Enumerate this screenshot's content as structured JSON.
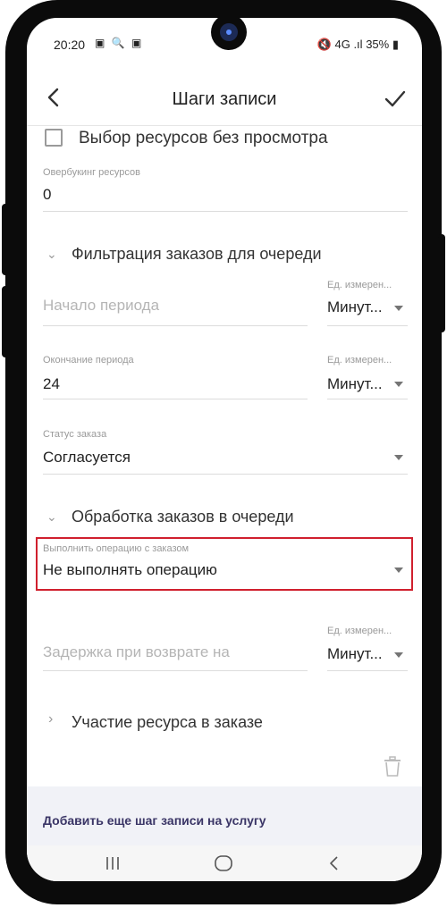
{
  "status_bar": {
    "time": "20:20",
    "left_icons": "▣ 🔍 ▣",
    "right_icons": "🔇 4G .ıl",
    "battery": "35%"
  },
  "app_bar": {
    "title": "Шаги записи"
  },
  "checkbox_no_preview": {
    "label": "Выбор ресурсов без просмотра"
  },
  "overbooking": {
    "label": "Овербукинг ресурсов",
    "value": "0"
  },
  "filter_section": {
    "title": "Фильтрация заказов для очереди"
  },
  "period_start": {
    "placeholder": "Начало периода",
    "unit_label": "Ед. измерен...",
    "unit_value": "Минут..."
  },
  "period_end": {
    "label": "Окончание периода",
    "value": "24",
    "unit_label": "Ед. измерен...",
    "unit_value": "Минут..."
  },
  "order_status": {
    "label": "Статус заказа",
    "value": "Согласуется"
  },
  "processing_section": {
    "title": "Обработка заказов в очереди"
  },
  "operation": {
    "label": "Выполнить операцию с заказом",
    "value": "Не выполнять операцию"
  },
  "return_delay": {
    "placeholder": "Задержка при возврате на",
    "unit_label": "Ед. измерен...",
    "unit_value": "Минут..."
  },
  "participation_section": {
    "title": "Участие ресурса в заказе"
  },
  "add_step": {
    "label": "Добавить еще шаг записи на услугу"
  },
  "icons": {
    "back": "chevron-left-icon",
    "confirm": "check-icon",
    "trash": "trash-icon",
    "recents": "recents-icon",
    "home": "home-icon",
    "nav_back": "nav-back-icon"
  },
  "colors": {
    "highlight": "#d0202e",
    "link": "#3a3566",
    "bottom_panel": "#f1f2f7"
  }
}
